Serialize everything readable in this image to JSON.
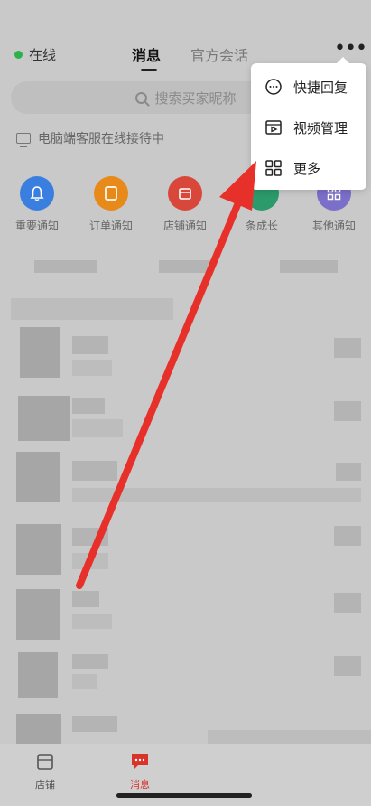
{
  "header": {
    "status": "在线",
    "tabs": [
      {
        "label": "消息",
        "active": true
      },
      {
        "label": "官方会话",
        "active": false
      }
    ],
    "more_label": "•••"
  },
  "search": {
    "placeholder": "搜索买家昵称"
  },
  "pc_status": "电脑端客服在线接待中",
  "categories": [
    {
      "label": "重要通知",
      "color": "#3a7fe0"
    },
    {
      "label": "订单通知",
      "color": "#e88a1a"
    },
    {
      "label": "店铺通知",
      "color": "#d9463a"
    },
    {
      "label": "条成长",
      "color": "#2c9a6a"
    },
    {
      "label": "其他通知",
      "color": "#7a6fc9"
    }
  ],
  "popup_menu": {
    "items": [
      {
        "label": "快捷回复",
        "icon": "chat-bubble-icon"
      },
      {
        "label": "视频管理",
        "icon": "video-icon"
      },
      {
        "label": "更多",
        "icon": "grid-icon"
      }
    ]
  },
  "bottom_nav": {
    "items": [
      {
        "label": "店铺",
        "active": false,
        "color": "#555555"
      },
      {
        "label": "消息",
        "active": true,
        "color": "#d9322a"
      }
    ]
  },
  "colors": {
    "accent_red": "#e8302a",
    "online_green": "#2bb24c"
  }
}
